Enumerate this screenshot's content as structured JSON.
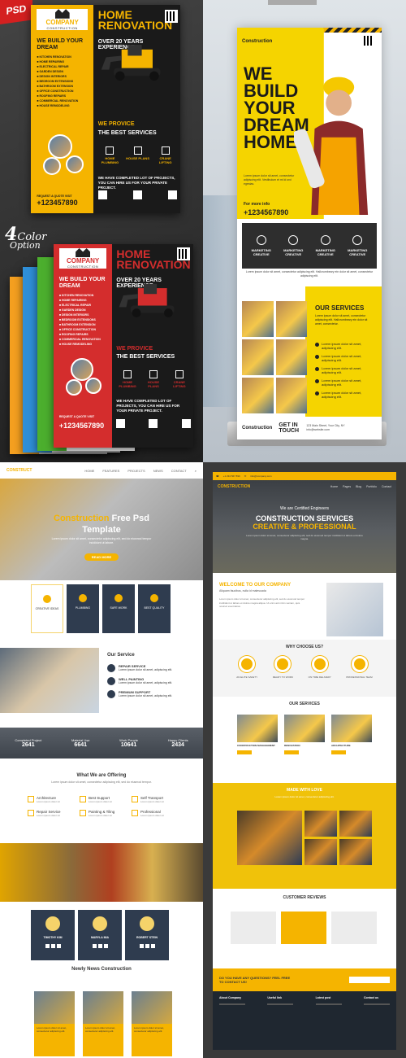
{
  "flyer_main": {
    "badge": "PSD",
    "company_name": "COMPANY",
    "company_sub": "CONSTRUCTION",
    "title_line1": "HOME",
    "title_line2": "RENOVATION",
    "subtitle": "OVER 20 YEARS EXPERIENCE",
    "we_build": "WE BUILD YOUR DREAM",
    "provide_line1": "WE PROVICE",
    "provide_line2": "THE BEST SERVICES",
    "services": [
      "HOME PLUMBING",
      "HOUSE PLANS",
      "CRANE LIFTING"
    ],
    "completed": "WE HAVE COMPLETED LOT OF PROJECTS, YOU CAN HIRE US FOR YOUR PRIVATE PROJECT.",
    "request": "REQUEST A QUOTE VISIT",
    "phone": "+123457890"
  },
  "color_option": {
    "number": "4",
    "word": "Color",
    "option": "Option"
  },
  "flyer_front": {
    "company_name": "COMPANY",
    "company_sub": "CONSTRUCTION",
    "title_line1": "HOME",
    "title_line2": "RENOVATION",
    "subtitle": "OVER 20 YEARS EXPERIENCE",
    "we_build": "WE BUILD YOUR DREAM",
    "provide_line1": "WE PROVICE",
    "provide_line2": "THE BEST SERVICES",
    "services": [
      "HOME PLUMBING",
      "HOUSE PLANS",
      "CRANE LIFTING"
    ],
    "completed": "WE HAVE COMPLETED LOT OF PROJECTS, YOU CAN HIRE US FOR YOUR PRIVATE PROJECT.",
    "request": "REQUEST A QUOTE VISIT",
    "phone": "+1234567890"
  },
  "rollup": {
    "brand": "Construction",
    "headline": "WE BUILD YOUR DREAM HOME",
    "more_info": "For more info",
    "phone": "+1234567890",
    "marketing": [
      "MARKETING CREATIVE",
      "MARKETING CREATIVE",
      "MARKETING CREATIVE",
      "MARKETING CREATIVE"
    ],
    "our_services": "OUR SERVICES",
    "checks": [
      "Lorem ipsum dolor sit amet, adipiscing elit.",
      "Lorem ipsum dolor sit amet, adipiscing elit.",
      "Lorem ipsum dolor sit amet, adipiscing elit.",
      "Lorem ipsum dolor sit amet, adipiscing elit.",
      "Lorem ipsum dolor sit amet, adipiscing elit."
    ],
    "footer_brand": "Construction",
    "footer_cta": "GET IN TOUCH"
  },
  "site_left": {
    "hero_title": "Construction Free Psd Template",
    "hero_button": "READ MORE",
    "cards": [
      "CREATIVE IDEAS",
      "PLUMBING",
      "SAFE WORK",
      "BEST QUALITY"
    ],
    "our_service": "Our Service",
    "service_items": [
      "REPAIR SERVICE",
      "WELL PAINTING",
      "PREMIUM SUPPORT"
    ],
    "stats": [
      {
        "label": "Completed Project",
        "value": "2641"
      },
      {
        "label": "Material Use",
        "value": "6641"
      },
      {
        "label": "Work People",
        "value": "10641"
      },
      {
        "label": "Happy Clients",
        "value": "2434"
      }
    ],
    "offer_title": "What We are Offering",
    "offers": [
      "Architecture",
      "Best Support",
      "Self Transport",
      "Repair Service",
      "Painting & Tiling",
      "Professional"
    ],
    "team": [
      "TIMOTHY KIM",
      "MARYLA MIA",
      "ROBERT STEIN"
    ],
    "news_title": "Newly News Construction"
  },
  "site_right": {
    "logo": "CONSTRUCTION",
    "certified": "We are Certified Engineers",
    "hero_line1": "CONSTRUCTION SERVICES",
    "hero_line2": "CREATIVE & PROFESSIONAL",
    "welcome_title": "WELCOME TO OUR COMPANY",
    "welcome_sub": "Aliquam faucibus, nulla id malesuada",
    "why_title": "WHY CHOOSE US?",
    "why_items": [
      "AN ELITE SAFETY",
      "READY TO WORK",
      "ON TIME DELIVERY",
      "PROFESSIONAL TEAM"
    ],
    "services_title": "OUR SERVICES",
    "services": [
      "CONSTRUCTION MANAGEMENT",
      "RENOVATION",
      "ARCHITECTURE"
    ],
    "made_title": "MADE WITH LOVE",
    "reviews_title": "CUSTOMER REVIEWS",
    "cta": "DO YOU HAVE ANY QUESTIONS? FEEL FREE TO CONTACT US!",
    "footer_cols": [
      "About Company",
      "Useful link",
      "Latest post",
      "Contact us"
    ]
  }
}
